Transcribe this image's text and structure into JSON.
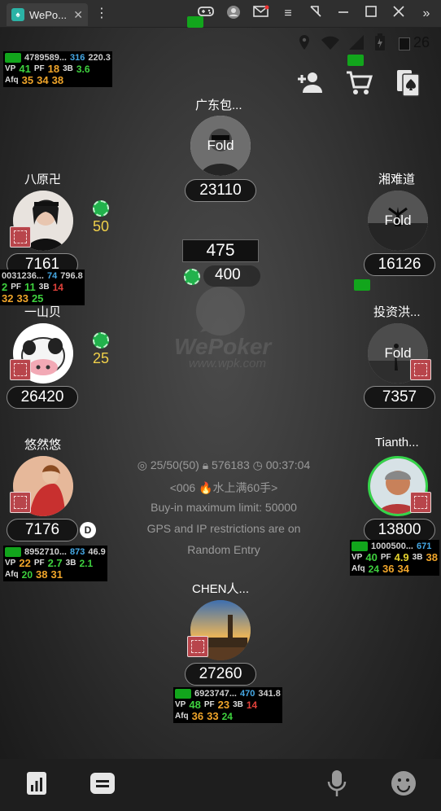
{
  "window": {
    "tab_title": "WePo...",
    "tab_close": "✕"
  },
  "status": {
    "time": "26"
  },
  "pot": {
    "main": "475",
    "bet": "400"
  },
  "watermark": {
    "logo": "WePoker",
    "url": "www.wpk.com"
  },
  "table_info": {
    "blinds": "25/50(50)",
    "table_id": "576183",
    "timer": "00:37:04",
    "tag": "<006 🔥水上满60手>",
    "buyin": "Buy-in maximum limit: 50000",
    "restrictions": "GPS and IP restrictions are on",
    "entry": "Random Entry"
  },
  "seats": {
    "top": {
      "name": "广东包...",
      "stack": "23110",
      "status": "Fold"
    },
    "left1": {
      "name": "八原卍",
      "stack": "7161",
      "bet": "50"
    },
    "right1": {
      "name": "湘难道",
      "stack": "16126",
      "status": "Fold"
    },
    "left2": {
      "name": "一山贝",
      "stack": "26420",
      "bet": "25"
    },
    "right2": {
      "name": "投资洪...",
      "stack": "7357",
      "status": "Fold"
    },
    "left3": {
      "name": "悠然悠",
      "stack": "7176",
      "dealer": "D"
    },
    "right3": {
      "name": "Tianth...",
      "stack": "13800"
    },
    "bottom": {
      "name": "CHEN人...",
      "stack": "27260"
    }
  },
  "huds": {
    "h1": {
      "id": "4789589...",
      "hands": "316",
      "bb": "220.3",
      "vp": "41",
      "pf": "18",
      "tb": "3.6",
      "afq": [
        "35",
        "34",
        "38"
      ]
    },
    "h2": {
      "id": "0031236...",
      "hands": "74",
      "bb": "796.8",
      "vp": "2",
      "pf": "11",
      "tb": "14",
      "afq": [
        "32",
        "33",
        "25"
      ]
    },
    "h3": {
      "id": "8952710...",
      "hands": "873",
      "bb": "46.9",
      "vp": "22",
      "pf": "2.7",
      "tb": "2.1",
      "afq": [
        "20",
        "38",
        "31"
      ]
    },
    "h4": {
      "id": "1000500...",
      "hands": "671",
      "bb": "",
      "vp": "40",
      "pf": "4.9",
      "tb": "38",
      "afq": [
        "24",
        "36",
        "34"
      ]
    },
    "h5": {
      "id": "6923747...",
      "hands": "470",
      "bb": "341.8",
      "vp": "48",
      "pf": "23",
      "tb": "14",
      "afq": [
        "36",
        "33",
        "24"
      ]
    }
  },
  "labels": {
    "vp": "VP",
    "pf": "PF",
    "tb": "3B",
    "afq": "Afq"
  },
  "icons": {
    "invite": "add-person-icon",
    "shop": "cart-icon",
    "cards": "card-spade-icon",
    "stats": "chart-icon",
    "menu": "menu-icon",
    "mic": "mic-icon",
    "emoji": "emoji-icon"
  }
}
